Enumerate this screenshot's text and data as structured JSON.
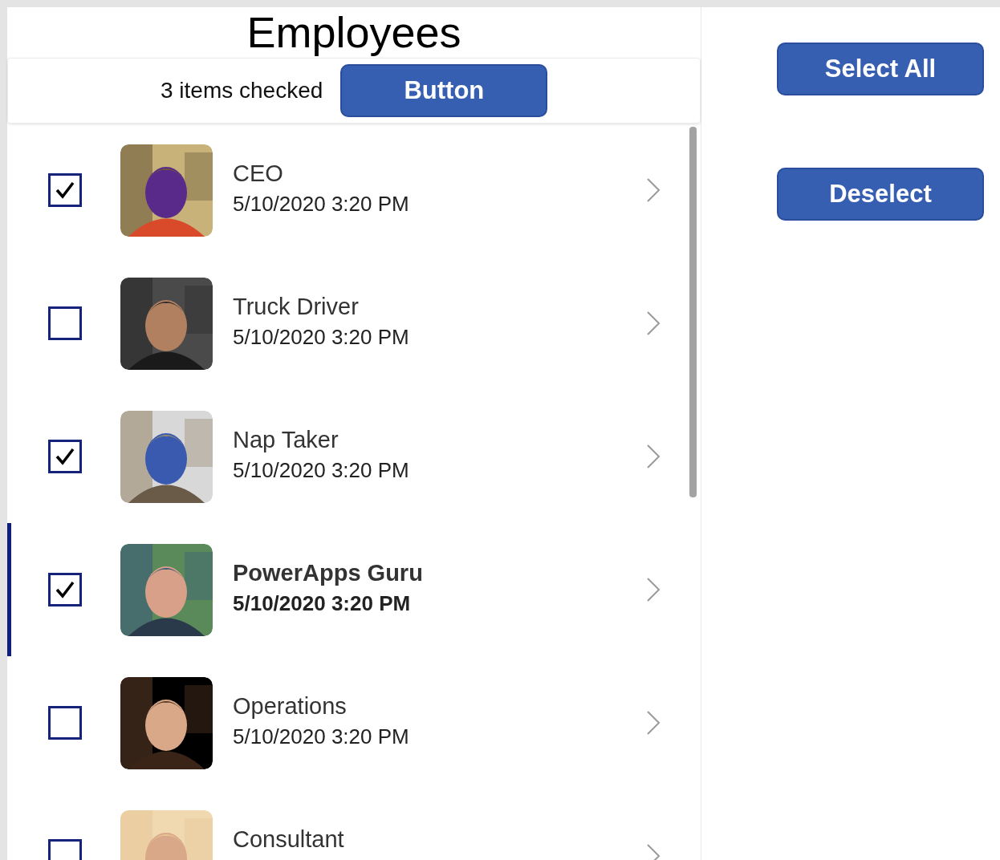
{
  "title": "Employees",
  "toolbar": {
    "status": "3 items checked",
    "button": "Button"
  },
  "employees": [
    {
      "title": "CEO",
      "date": "5/10/2020 3:20 PM",
      "checked": true,
      "selected": false
    },
    {
      "title": "Truck Driver",
      "date": "5/10/2020 3:20 PM",
      "checked": false,
      "selected": false
    },
    {
      "title": "Nap Taker",
      "date": "5/10/2020 3:20 PM",
      "checked": true,
      "selected": false
    },
    {
      "title": "PowerApps Guru",
      "date": "5/10/2020 3:20 PM",
      "checked": true,
      "selected": true
    },
    {
      "title": "Operations",
      "date": "5/10/2020 3:20 PM",
      "checked": false,
      "selected": false
    },
    {
      "title": "Consultant",
      "checked": false,
      "selected": false
    }
  ],
  "actions": [
    "Select All",
    "Deselect"
  ]
}
